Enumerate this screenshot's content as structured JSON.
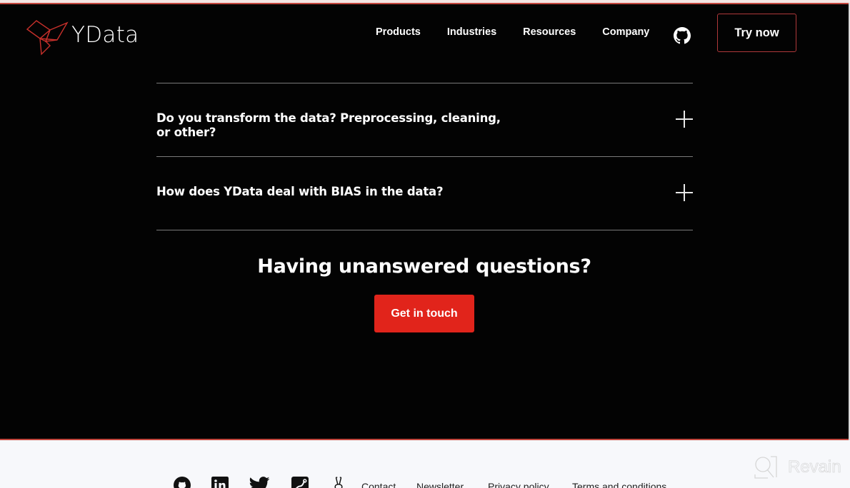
{
  "header": {
    "brand": "YData",
    "nav": [
      {
        "label": "Products"
      },
      {
        "label": "Industries"
      },
      {
        "label": "Resources"
      },
      {
        "label": "Company"
      }
    ],
    "github_icon": "github-icon",
    "cta_label": "Try now"
  },
  "faq": {
    "items": [
      {
        "question": "",
        "partially_hidden": true
      },
      {
        "question": "Do you transform the data? Preprocessing, cleaning, or other?",
        "expanded": false
      },
      {
        "question": "How does YData deal with BIAS in the data?",
        "expanded": false
      }
    ],
    "toggle_icon": "plus-icon"
  },
  "cta": {
    "title": "Having unanswered questions?",
    "button_label": "Get in touch"
  },
  "footer": {
    "social": [
      "github-icon",
      "linkedin-icon",
      "twitter-icon",
      "medium-icon",
      "rabbit-icon"
    ],
    "links": [
      {
        "label": "Contact"
      },
      {
        "label": "Newsletter"
      },
      {
        "label": "Privacy policy"
      },
      {
        "label": "Terms and conditions"
      }
    ]
  },
  "watermark": {
    "label": "Revain"
  },
  "colors": {
    "accent": "#e1241b",
    "border_accent": "#b0383a",
    "background": "#030303"
  }
}
